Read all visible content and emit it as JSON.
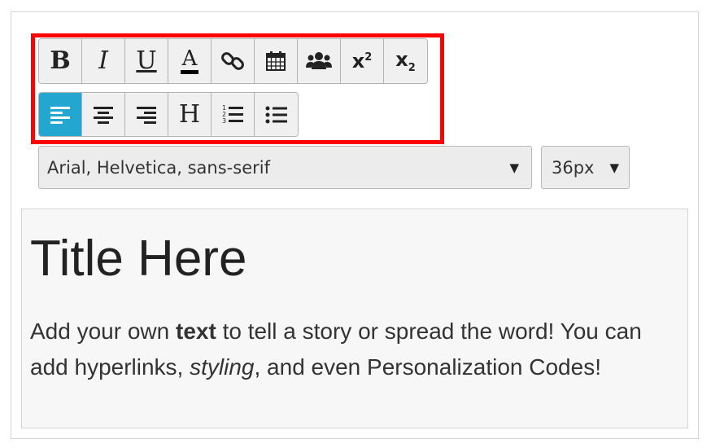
{
  "toolbar": {
    "row1": [
      {
        "name": "bold-button",
        "icon": "bold-icon",
        "label": "B"
      },
      {
        "name": "italic-button",
        "icon": "italic-icon",
        "label": "I"
      },
      {
        "name": "underline-button",
        "icon": "underline-icon",
        "label": "U"
      },
      {
        "name": "font-color-button",
        "icon": "font-color-icon",
        "label": "A"
      },
      {
        "name": "link-button",
        "icon": "link-icon"
      },
      {
        "name": "calendar-button",
        "icon": "calendar-icon"
      },
      {
        "name": "personalization-button",
        "icon": "users-icon"
      },
      {
        "name": "superscript-button",
        "icon": "superscript-icon",
        "label": "x",
        "sup": "2"
      },
      {
        "name": "subscript-button",
        "icon": "subscript-icon",
        "label": "x",
        "sub": "2"
      }
    ],
    "row2": [
      {
        "name": "align-left-button",
        "icon": "align-left-icon",
        "active": true
      },
      {
        "name": "align-center-button",
        "icon": "align-center-icon"
      },
      {
        "name": "align-right-button",
        "icon": "align-right-icon"
      },
      {
        "name": "heading-button",
        "icon": "heading-icon",
        "label": "H"
      },
      {
        "name": "ordered-list-button",
        "icon": "ordered-list-icon"
      },
      {
        "name": "unordered-list-button",
        "icon": "unordered-list-icon"
      }
    ],
    "active_color": "#23a6cf",
    "highlight_color": "#ff0000"
  },
  "font_select": {
    "value": "Arial, Helvetica, sans-serif",
    "caret": "▼"
  },
  "size_select": {
    "value": "36px",
    "caret": "▼"
  },
  "editor": {
    "title": "Title Here",
    "body": {
      "p1": "Add your own ",
      "bold": "text",
      "p2": " to tell a story or spread the word! You can add hyperlinks, ",
      "italic": "styling",
      "p3": ", and even Personalization Codes!"
    }
  }
}
